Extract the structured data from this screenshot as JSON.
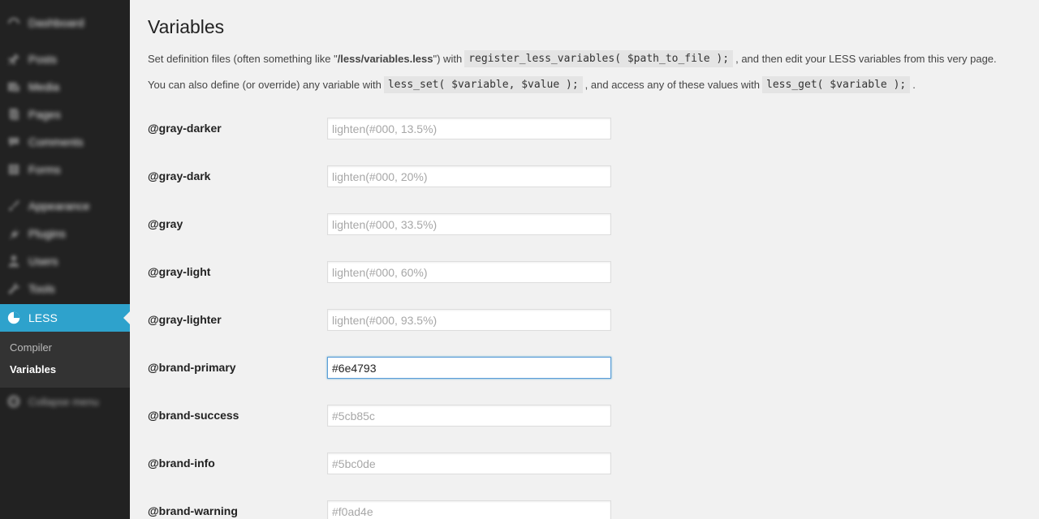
{
  "sidebar": {
    "items": [
      {
        "label": "Dashboard",
        "icon": "dashboard-icon"
      },
      {
        "label": "Posts",
        "icon": "pin-icon"
      },
      {
        "label": "Media",
        "icon": "media-icon"
      },
      {
        "label": "Pages",
        "icon": "pages-icon"
      },
      {
        "label": "Comments",
        "icon": "comment-icon"
      },
      {
        "label": "Forms",
        "icon": "forms-icon"
      },
      {
        "label": "Appearance",
        "icon": "brush-icon"
      },
      {
        "label": "Plugins",
        "icon": "plug-icon"
      },
      {
        "label": "Users",
        "icon": "user-icon"
      },
      {
        "label": "Tools",
        "icon": "wrench-icon"
      }
    ],
    "current": {
      "label": "LESS",
      "icon": "less-icon"
    },
    "submenu": [
      {
        "label": "Compiler"
      },
      {
        "label": "Variables",
        "current": true
      }
    ],
    "collapse_label": "Collapse menu"
  },
  "main": {
    "title": "Variables",
    "desc1": {
      "part1": "Set definition files (often something like \"",
      "bold": "/less/variables.less",
      "part2": "\") with",
      "code": "register_less_variables( $path_to_file );",
      "part3": ", and then edit your LESS variables from this very page."
    },
    "desc2": {
      "part1": "You can also define (or override) any variable with",
      "code1": "less_set( $variable, $value );",
      "part2": ", and access any of these values with",
      "code2": "less_get( $variable );",
      "part3": "."
    },
    "variables": [
      {
        "name": "@gray-darker",
        "value": "",
        "placeholder": "lighten(#000, 13.5%)"
      },
      {
        "name": "@gray-dark",
        "value": "",
        "placeholder": "lighten(#000, 20%)"
      },
      {
        "name": "@gray",
        "value": "",
        "placeholder": "lighten(#000, 33.5%)"
      },
      {
        "name": "@gray-light",
        "value": "",
        "placeholder": "lighten(#000, 60%)"
      },
      {
        "name": "@gray-lighter",
        "value": "",
        "placeholder": "lighten(#000, 93.5%)"
      },
      {
        "name": "@brand-primary",
        "value": "#6e4793",
        "placeholder": ""
      },
      {
        "name": "@brand-success",
        "value": "",
        "placeholder": "#5cb85c"
      },
      {
        "name": "@brand-info",
        "value": "",
        "placeholder": "#5bc0de"
      },
      {
        "name": "@brand-warning",
        "value": "",
        "placeholder": "#f0ad4e"
      }
    ]
  },
  "colors": {
    "sidebar_bg": "#222222",
    "accent": "#2ea2cc",
    "content_bg": "#f1f1f1"
  }
}
